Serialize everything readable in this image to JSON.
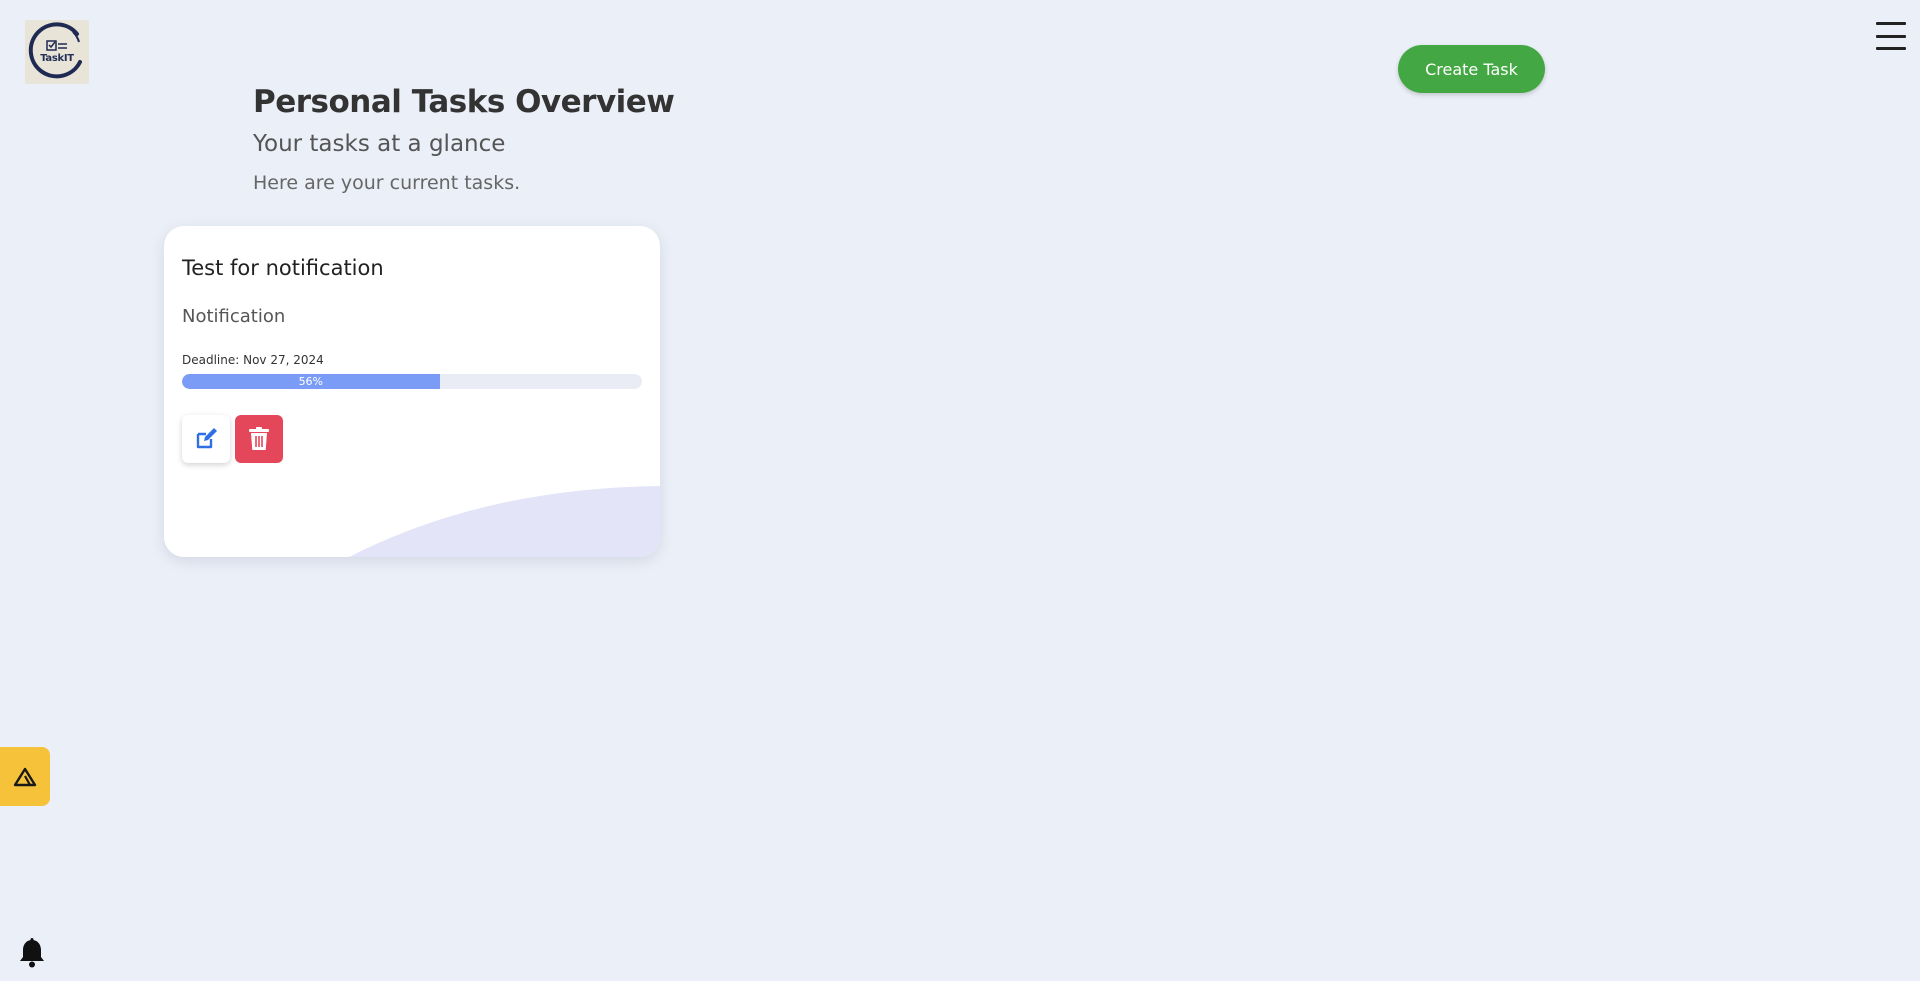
{
  "app": {
    "logo_text": "TaskIT"
  },
  "header": {
    "create_task_label": "Create Task"
  },
  "main": {
    "title": "Personal Tasks Overview",
    "subtitle": "Your tasks at a glance",
    "description": "Here are your current tasks."
  },
  "tasks": [
    {
      "title": "Test for notification",
      "category": "Notification",
      "deadline": "Deadline: Nov 27, 2024",
      "progress": 0.56,
      "progress_label": "56%"
    }
  ],
  "icons": {
    "menu": "hamburger-icon",
    "edit": "edit-icon",
    "delete": "trash-icon",
    "side_widget": "triangle-logo-icon",
    "notifications": "bell-icon"
  },
  "colors": {
    "background": "#ebeff7",
    "accent_green": "#43a843",
    "progress_blue": "#7b9cf6",
    "delete_red": "#e5475a",
    "edit_blue": "#2f6fe4",
    "widget_yellow": "#f6c23a"
  }
}
